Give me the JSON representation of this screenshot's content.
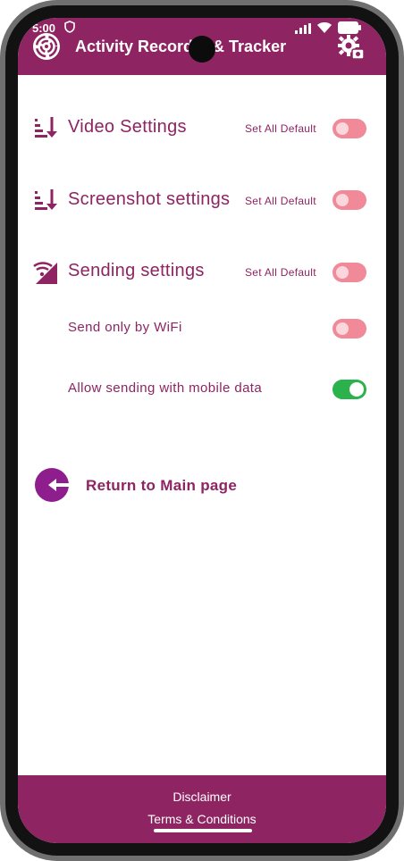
{
  "status_bar": {
    "time": "5:00",
    "icons": [
      "shield-icon",
      "signal-icon",
      "wifi-icon",
      "battery-icon"
    ]
  },
  "app_bar": {
    "title": "Activity Recorder & Tracker",
    "logo_icon": "app-logo-icon",
    "action_icon": "settings-gear-icon"
  },
  "settings": {
    "video": {
      "label": "Video Settings",
      "default_label": "Set All Default",
      "toggle_on": false,
      "icon": "sort-down-icon"
    },
    "screenshot": {
      "label": "Screenshot settings",
      "default_label": "Set All Default",
      "toggle_on": false,
      "icon": "sort-down-icon"
    },
    "sending": {
      "label": "Sending settings",
      "default_label": "Set All Default",
      "toggle_on": false,
      "icon": "signal-wifi-icon"
    },
    "wifi_only": {
      "label": "Send only by WiFi",
      "toggle_on": false
    },
    "mobile_data": {
      "label": "Allow sending with mobile data",
      "toggle_on": true
    }
  },
  "return_main": {
    "label": "Return to Main page",
    "icon": "back-arrow-circle-icon"
  },
  "footer": {
    "disclaimer": "Disclaimer",
    "terms": "Terms & Conditions"
  },
  "colors": {
    "primary": "#8e2462",
    "toggle_off": "#f08a98",
    "toggle_on": "#2bb24c",
    "background": "#ffffff"
  }
}
